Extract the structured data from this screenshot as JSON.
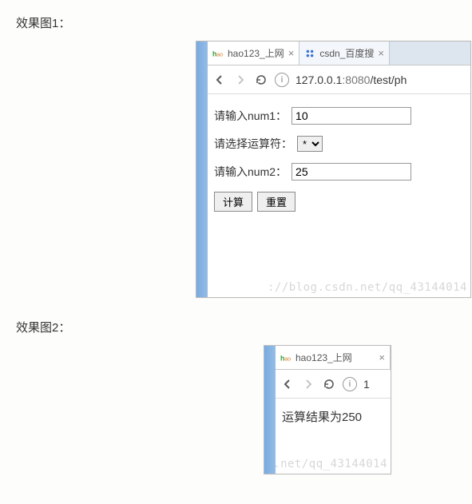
{
  "figure1": {
    "caption": "效果图1：",
    "tabs": [
      {
        "title": "hao123_上网",
        "favicon": "hao"
      },
      {
        "title": "csdn_百度搜",
        "favicon": "baidu"
      }
    ],
    "addressbar": {
      "url_host": "127.0.0.1",
      "url_port": ":8080",
      "url_path": "/test/ph"
    },
    "form": {
      "label_num1": "请输入num1：",
      "value_num1": "10",
      "label_op": "请选择运算符：",
      "op_selected": "*",
      "label_num2": "请输入num2：",
      "value_num2": "25",
      "btn_calc": "计算",
      "btn_reset": "重置"
    },
    "watermark": "://blog.csdn.net/qq_43144014"
  },
  "figure2": {
    "caption": "效果图2：",
    "tabs": [
      {
        "title": "hao123_上网",
        "favicon": "hao"
      }
    ],
    "addressbar": {
      "url_trunc": "1"
    },
    "result": "运算结果为250",
    "watermark": ".net/qq_43144014"
  }
}
